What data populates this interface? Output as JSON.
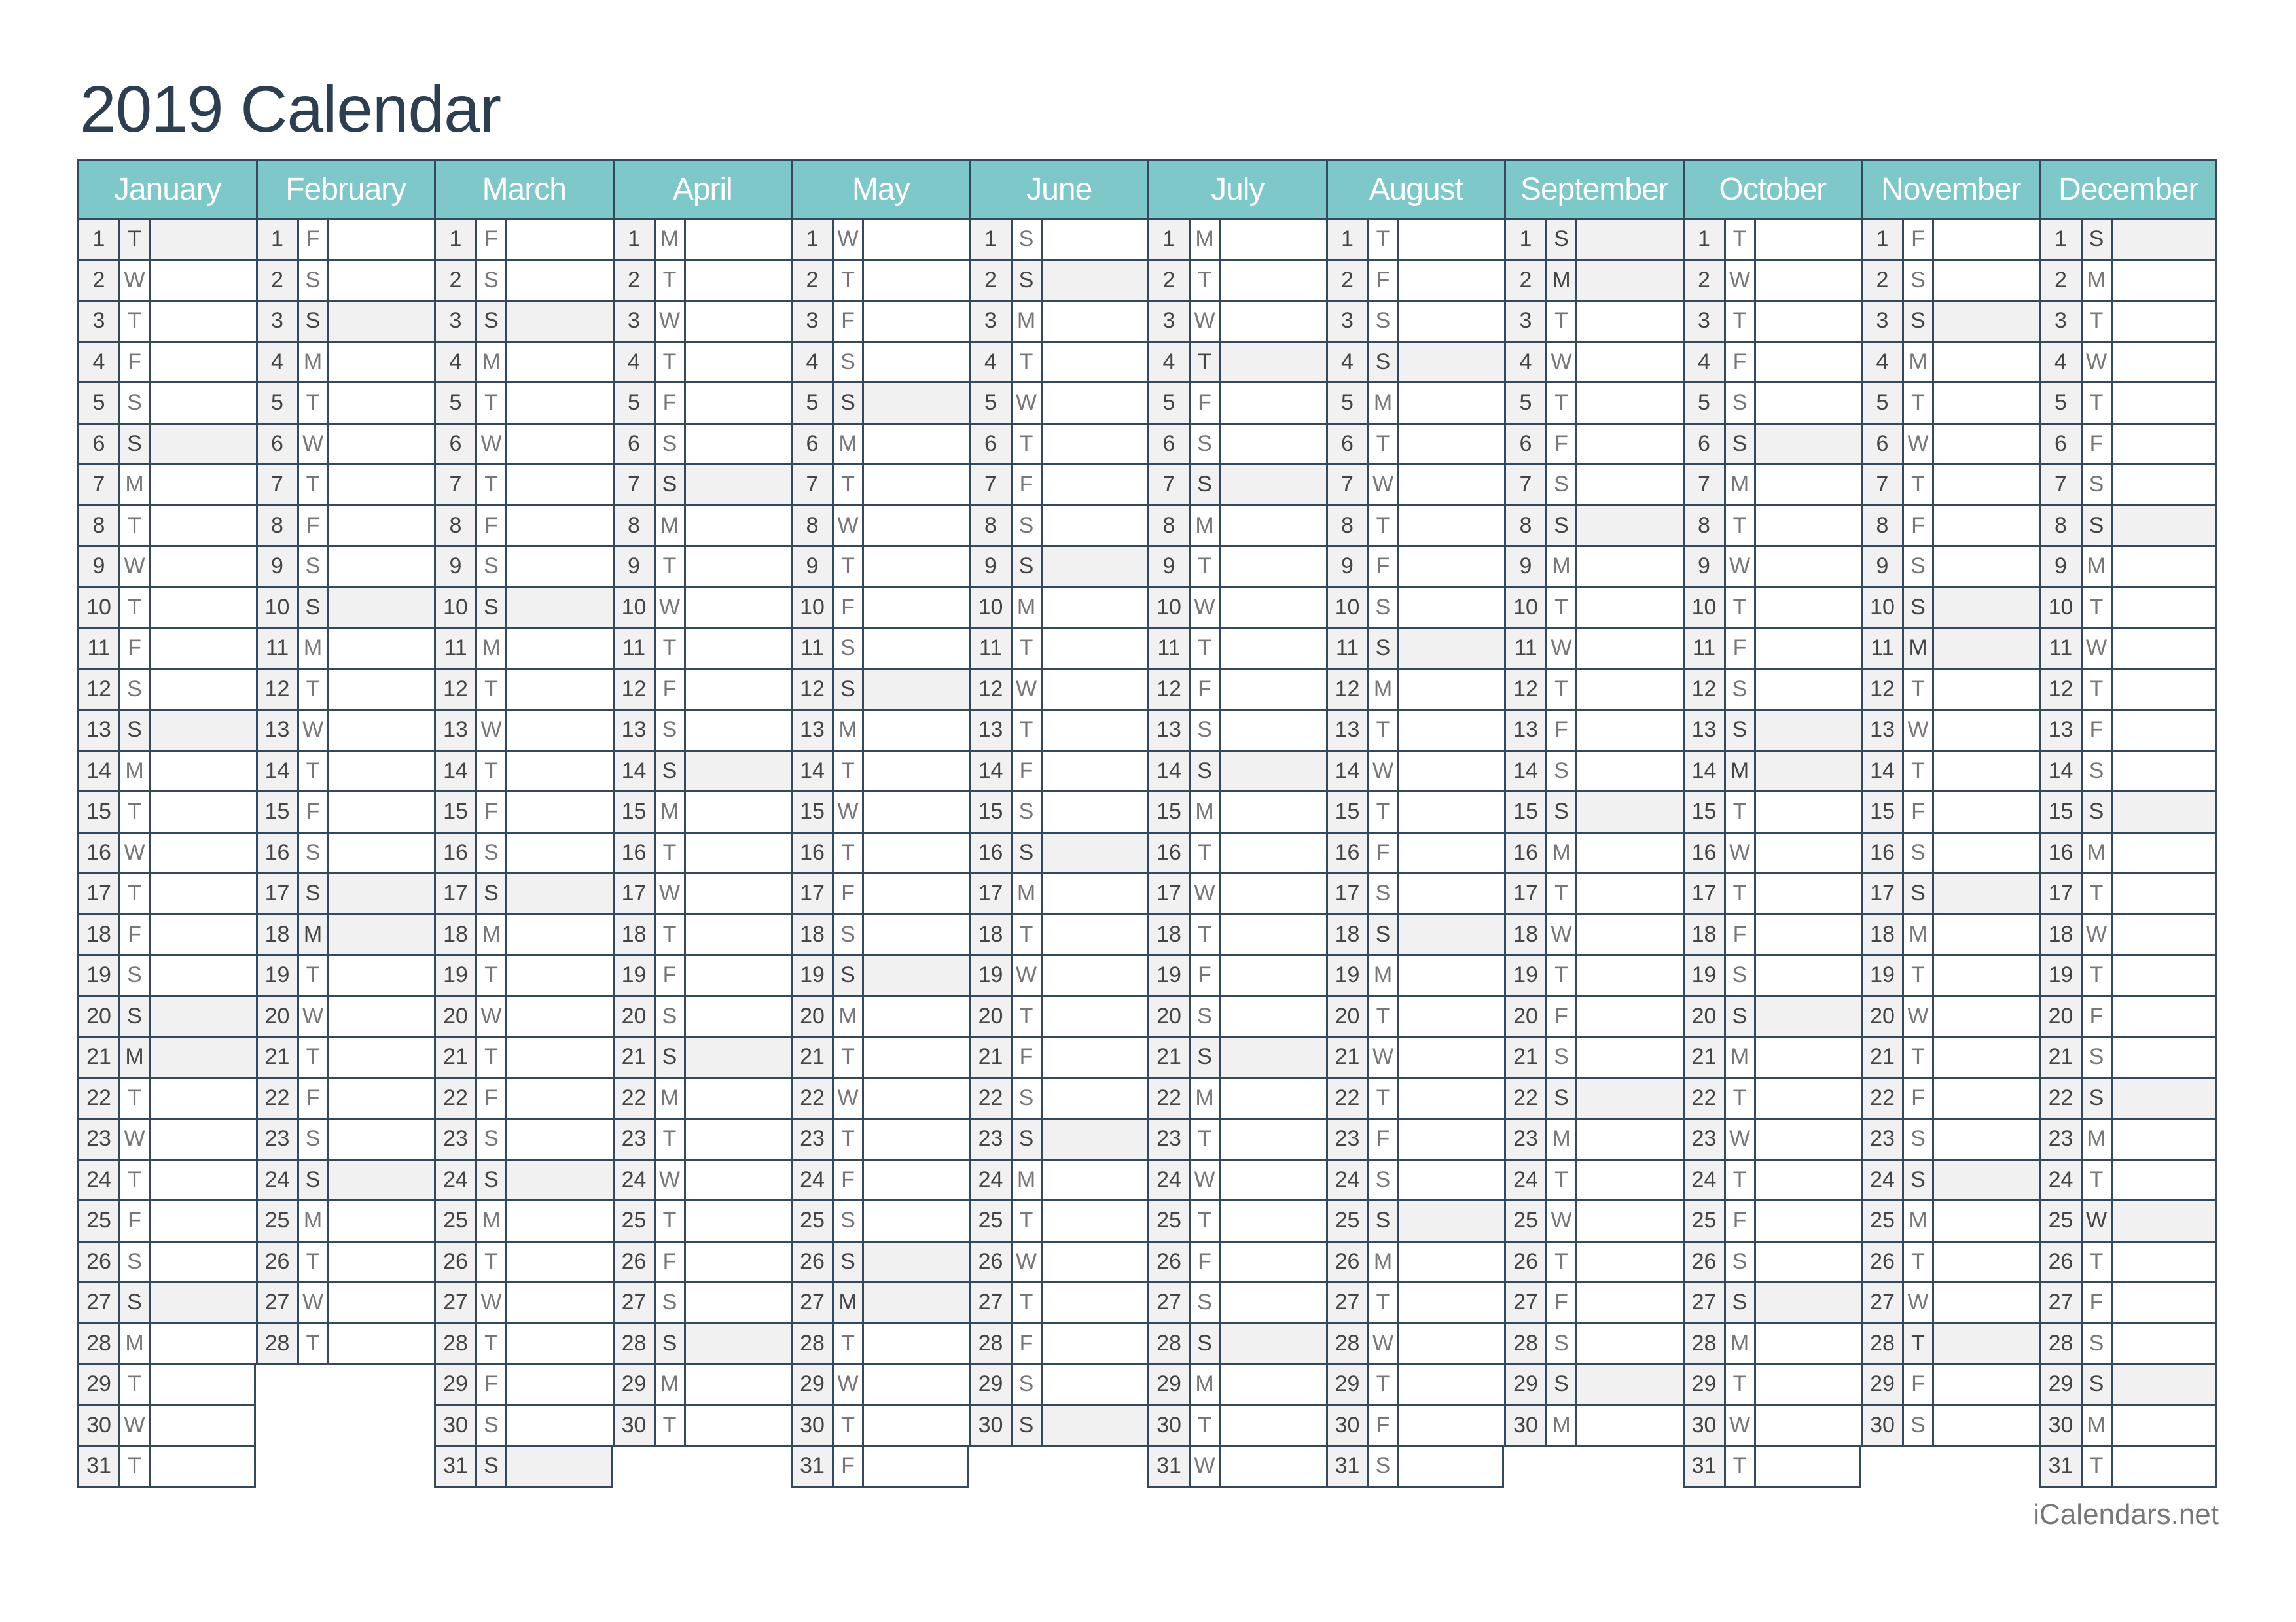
{
  "title": "2019 Calendar",
  "footer": "iCalendars.net",
  "colors": {
    "header_bg": "#7ec8ca",
    "border": "#34495e",
    "highlight_bg": "#f1f1f1",
    "title": "#2c3e50"
  },
  "months": [
    {
      "name": "January",
      "weekdays": "TWTFSSMTWTFSSMTWTFSSMTWTFSSMTWT",
      "highlighted": [
        1,
        6,
        13,
        20,
        21,
        27
      ]
    },
    {
      "name": "February",
      "weekdays": "FSSMTWTFSSMTWTFSSMTWTFSSMTWT",
      "highlighted": [
        3,
        10,
        17,
        18,
        24
      ]
    },
    {
      "name": "March",
      "weekdays": "FSSMTWTFSSMTWTFSSMTWTFSSMTWTFSS",
      "highlighted": [
        3,
        10,
        17,
        24,
        31
      ]
    },
    {
      "name": "April",
      "weekdays": "MTWTFSSMTWTFSSMTWTFSSMTWTFSSMT",
      "highlighted": [
        7,
        14,
        21,
        28
      ]
    },
    {
      "name": "May",
      "weekdays": "WTFSSMTWTFSSMTWTFSSMTWTFSSMTWTF",
      "highlighted": [
        5,
        12,
        19,
        26,
        27
      ]
    },
    {
      "name": "June",
      "weekdays": "SSMTWTFSSMTWTFSSMTWTFSSMTWTFSS",
      "highlighted": [
        2,
        9,
        16,
        23,
        30
      ]
    },
    {
      "name": "July",
      "weekdays": "MTWTFSSMTWTFSSMTWTFSSMTWTFSSMTW",
      "highlighted": [
        4,
        7,
        14,
        21,
        28
      ]
    },
    {
      "name": "August",
      "weekdays": "TFSSMTWTFSSMTWTFSSMTWTFSSMTWTFS",
      "highlighted": [
        4,
        11,
        18,
        25
      ]
    },
    {
      "name": "September",
      "weekdays": "SMTWTFSSMTWTFSSMTWTFSSMTWTFSSM",
      "highlighted": [
        1,
        2,
        8,
        15,
        22,
        29
      ]
    },
    {
      "name": "October",
      "weekdays": "TWTFSSMTWTFSSMTWTFSSMTWTFSSMTWT",
      "highlighted": [
        6,
        13,
        14,
        20,
        27
      ]
    },
    {
      "name": "November",
      "weekdays": "FSSMTWTFSSMTWTFSSMTWTFSSMTWTFS",
      "highlighted": [
        3,
        10,
        11,
        17,
        24,
        28
      ]
    },
    {
      "name": "December",
      "weekdays": "SMTWTFSSMTWTFSSMTWTFSSMTWTFSSMT",
      "highlighted": [
        1,
        8,
        15,
        22,
        25,
        29
      ]
    }
  ]
}
